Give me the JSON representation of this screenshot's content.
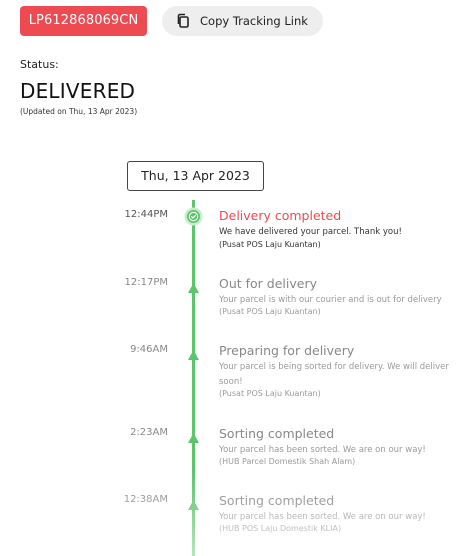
{
  "header": {
    "tracking_number": "LP612868069CN",
    "copy_button_label": "Copy Tracking Link",
    "copy_icon": "copy-icon"
  },
  "status": {
    "label": "Status:",
    "value": "DELIVERED",
    "updated": "(Updated on Thu, 13 Apr 2023)"
  },
  "timeline": {
    "date": "Thu, 13 Apr 2023",
    "events": [
      {
        "time": "12:44PM",
        "title": "Delivery completed",
        "desc": "We have delivered your parcel. Thank you!",
        "location": "(Pusat POS Laju Kuantan)"
      },
      {
        "time": "12:17PM",
        "title": "Out for delivery",
        "desc": "Your parcel is with our courier and is out for delivery",
        "location": "(Pusat POS Laju Kuantan)"
      },
      {
        "time": "9:46AM",
        "title": "Preparing for delivery",
        "desc": "Your parcel is being sorted for delivery. We will deliver soon!",
        "location": "(Pusat POS Laju Kuantan)"
      },
      {
        "time": "2:23AM",
        "title": "Sorting completed",
        "desc": "Your parcel has been sorted. We are on our way!",
        "location": "(HUB Parcel Domestik Shah Alam)"
      },
      {
        "time": "12:38AM",
        "title": "Sorting completed",
        "desc": "Your parcel has been sorted. We are on our way!",
        "location": "(HUB POS Laju Domestik KLIA)"
      }
    ]
  },
  "colors": {
    "accent_red": "#ee4a52",
    "timeline_green": "#5cc46b"
  }
}
